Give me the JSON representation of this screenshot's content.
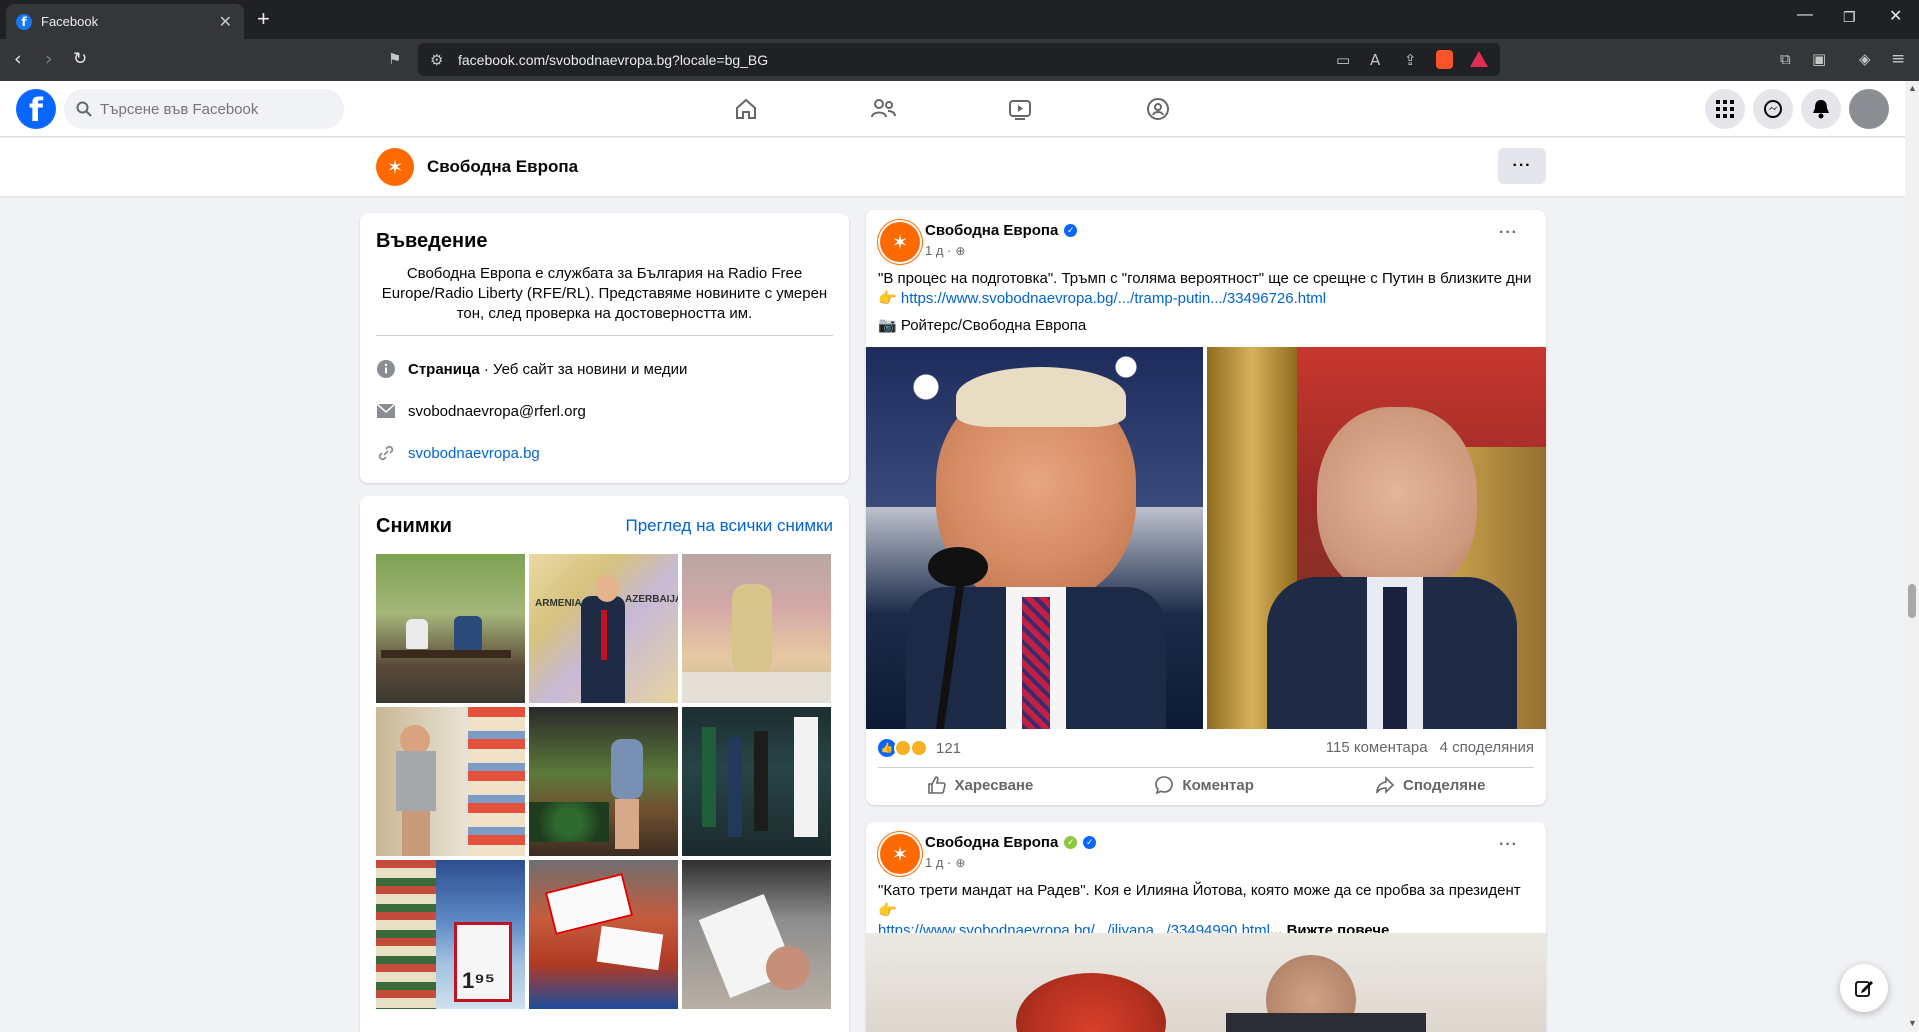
{
  "browser": {
    "tab_title": "Facebook",
    "url": "facebook.com/svobodnaevropa.bg?locale=bg_BG"
  },
  "fb": {
    "search_placeholder": "Търсене във Facebook"
  },
  "page": {
    "name": "Свободна Европа"
  },
  "intro": {
    "heading": "Въведение",
    "text": "Свободна Европа е службата за България на Radio Free Europe/Radio Liberty (RFE/RL). Представяме новините с умерен тон, след проверка на достоверността им.",
    "category_bold": "Страница",
    "category_rest": " · Уеб сайт за новини и медии",
    "email": "svobodnaevropa@rferl.org",
    "website": "svobodnaevropa.bg"
  },
  "photos": {
    "heading": "Снимки",
    "see_all": "Преглед на всички снимки"
  },
  "posts": [
    {
      "author": "Свободна Европа",
      "time": "1 д ·",
      "text": "\"В процес на подготовка\". Тръмп с \"голяма вероятност\" ще се срещне с Путин в близките дни",
      "emoji": "👉",
      "link": "https://www.svobodnaevropa.bg/.../tramp-putin.../33496726.html",
      "credit": "📷 Ройтерс/Свободна Европа",
      "reactions": "121",
      "comments": "115 коментара",
      "shares": "4 споделяния",
      "like": "Харесване",
      "comment": "Коментар",
      "share": "Споделяне"
    },
    {
      "author": "Свободна Европа",
      "time": "1 д ·",
      "text": "\"Като трети мандат на Радев\". Коя е Илияна Йотова, която може да се пробва за президент",
      "emoji": "👉",
      "link": "https://www.svobodnaevropa.bg/.../iliyana.../33494990.html",
      "more": "... Вижте повече"
    }
  ],
  "colors": {
    "fb_blue": "#0866ff",
    "rfe_orange": "#ff6a00",
    "link": "#0064d1"
  }
}
